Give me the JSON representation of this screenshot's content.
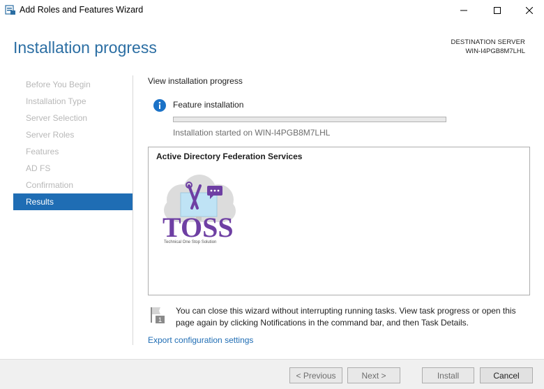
{
  "window": {
    "title": "Add Roles and Features Wizard",
    "icons": {
      "app": "server-manager-icon",
      "minimize": "minimize-icon",
      "maximize": "maximize-icon",
      "close": "close-icon"
    }
  },
  "header": {
    "page_title": "Installation progress",
    "destination_label": "DESTINATION SERVER",
    "destination_server": "WIN-I4PGB8M7LHL"
  },
  "nav": {
    "items": [
      {
        "label": "Before You Begin",
        "state": "disabled"
      },
      {
        "label": "Installation Type",
        "state": "disabled"
      },
      {
        "label": "Server Selection",
        "state": "disabled"
      },
      {
        "label": "Server Roles",
        "state": "disabled"
      },
      {
        "label": "Features",
        "state": "disabled"
      },
      {
        "label": "AD FS",
        "state": "disabled"
      },
      {
        "label": "Confirmation",
        "state": "disabled"
      },
      {
        "label": "Results",
        "state": "active"
      }
    ]
  },
  "main": {
    "section_label": "View installation progress",
    "feature_label": "Feature installation",
    "progress_percent": 0,
    "started_text": "Installation started on WIN-I4PGB8M7LHL",
    "results_box": {
      "title": "Active Directory Federation Services",
      "logo_text": "TOSS",
      "logo_tagline": "Technical One Stop Solution"
    },
    "note": "You can close this wizard without interrupting running tasks. View task progress or open this page again by clicking Notifications in the command bar, and then Task Details.",
    "notification_badge": "1",
    "export_link": "Export configuration settings"
  },
  "footer": {
    "previous_label": "< Previous",
    "next_label": "Next >",
    "install_label": "Install",
    "cancel_label": "Cancel"
  },
  "colors": {
    "accent": "#1f6db4",
    "title_blue": "#2b6ea3",
    "nav_disabled": "#b8b8b8",
    "info_blue": "#1b72c7"
  }
}
